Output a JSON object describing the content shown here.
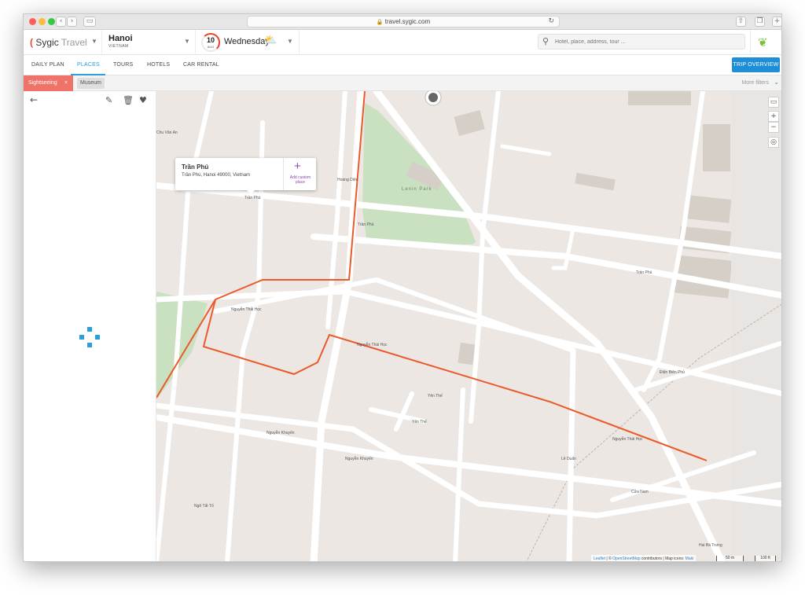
{
  "browser": {
    "url": "travel.sygic.com",
    "lock_icon": "lock-icon",
    "back_icon": "back-arrow-icon",
    "forward_icon": "forward-arrow-icon",
    "back_glyph": "‹",
    "forward_glyph": "›"
  },
  "app": {
    "brand_main": "Sygic",
    "brand_sub": "Travel",
    "city": "Hanoi",
    "country": "VIETNAM",
    "date_day": "10",
    "date_month": "AUG",
    "weekday": "Wednesday",
    "search_placeholder": "Hotel, place, address, tour ...",
    "accent_color": "#1e8ed6",
    "brand_color": "#e8432c"
  },
  "tabs": [
    {
      "label": "DAILY PLAN",
      "active": false
    },
    {
      "label": "PLACES",
      "active": true
    },
    {
      "label": "TOURS",
      "active": false
    },
    {
      "label": "HOTELS",
      "active": false
    },
    {
      "label": "CAR RENTAL",
      "active": false
    }
  ],
  "trip_overview_label": "TRIP OVERVIEW",
  "filters": {
    "active": "Sightseeing",
    "remove_glyph": "×",
    "secondary": "Museum",
    "more": "More filters"
  },
  "popup": {
    "title": "Trần Phú",
    "address": "Trần Phú, Hanoi 49000, Vietnam",
    "add_label": "Add custom place"
  },
  "map": {
    "park_label": "Lenin Park",
    "street_labels": [
      {
        "text": "Trần Phú"
      },
      {
        "text": "Trần Phú"
      },
      {
        "text": "Trần Phú"
      },
      {
        "text": "Nguyễn Thái Học"
      },
      {
        "text": "Nguyễn Thái Học"
      },
      {
        "text": "Nguyễn Thái Học"
      },
      {
        "text": "Cửa Nam"
      },
      {
        "text": "Nguyễn Khuyến"
      },
      {
        "text": "Nguyễn Khuyến"
      },
      {
        "text": "Yên Thế"
      },
      {
        "text": "Yên Thế"
      },
      {
        "text": "Lê Duẩn"
      },
      {
        "text": "Điện Biên Phủ"
      },
      {
        "text": "Hoàng Diệu"
      },
      {
        "text": "Chu Văn An"
      },
      {
        "text": "Hai Bà Trưng"
      },
      {
        "text": "Ngô Tất Tố"
      }
    ],
    "zoom_in": "+",
    "zoom_out": "−",
    "attribution_leaflet": "Leaflet",
    "attribution_osm": "OpenStreetMap",
    "attribution_rest": "contributors | Map icons:",
    "attribution_maki": "Maki",
    "scale_metric": "50 m",
    "scale_imperial": "100 ft",
    "route_color": "#ea5a2c"
  }
}
